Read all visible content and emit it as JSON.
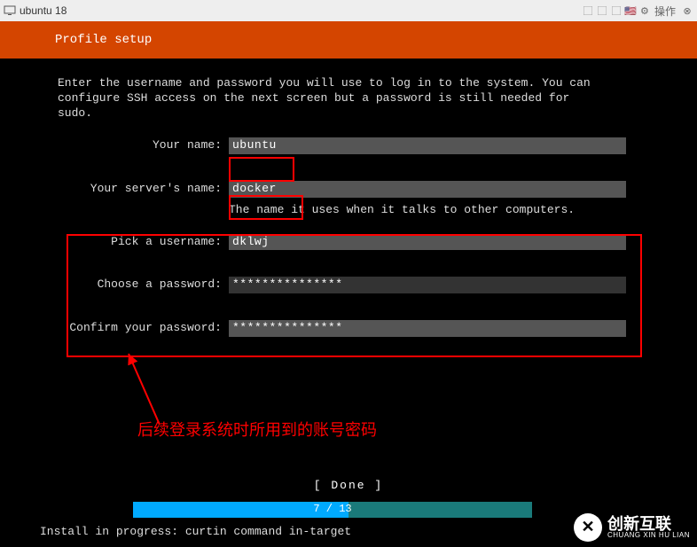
{
  "titlebar": {
    "title": "ubuntu 18",
    "action_label": "操作"
  },
  "header": {
    "title": "Profile setup"
  },
  "intro_text": "Enter the username and password you will use to log in to the system. You can\nconfigure SSH access on the next screen but a password is still needed for\nsudo.",
  "form": {
    "name_label": "Your name:",
    "name_value": "ubuntu",
    "server_label": "Your server's name:",
    "server_value": "docker",
    "server_hint": "The name it uses when it talks to other computers.",
    "username_label": "Pick a username:",
    "username_value": "dklwj",
    "pw_label": "Choose a password:",
    "pw_value": "***************",
    "pw2_label": "Confirm your password:",
    "pw2_value": "***************"
  },
  "button": {
    "done": "[ Done       ]"
  },
  "progress": {
    "current": 7,
    "total": 13,
    "text": "7 / 13",
    "percent": 54
  },
  "status_line": "Install in progress: curtin command in-target",
  "annotation": "后续登录系统时所用到的账号密码",
  "watermark": {
    "symbol": "✕",
    "cn": "创新互联",
    "en": "CHUANG XIN HU LIAN"
  }
}
